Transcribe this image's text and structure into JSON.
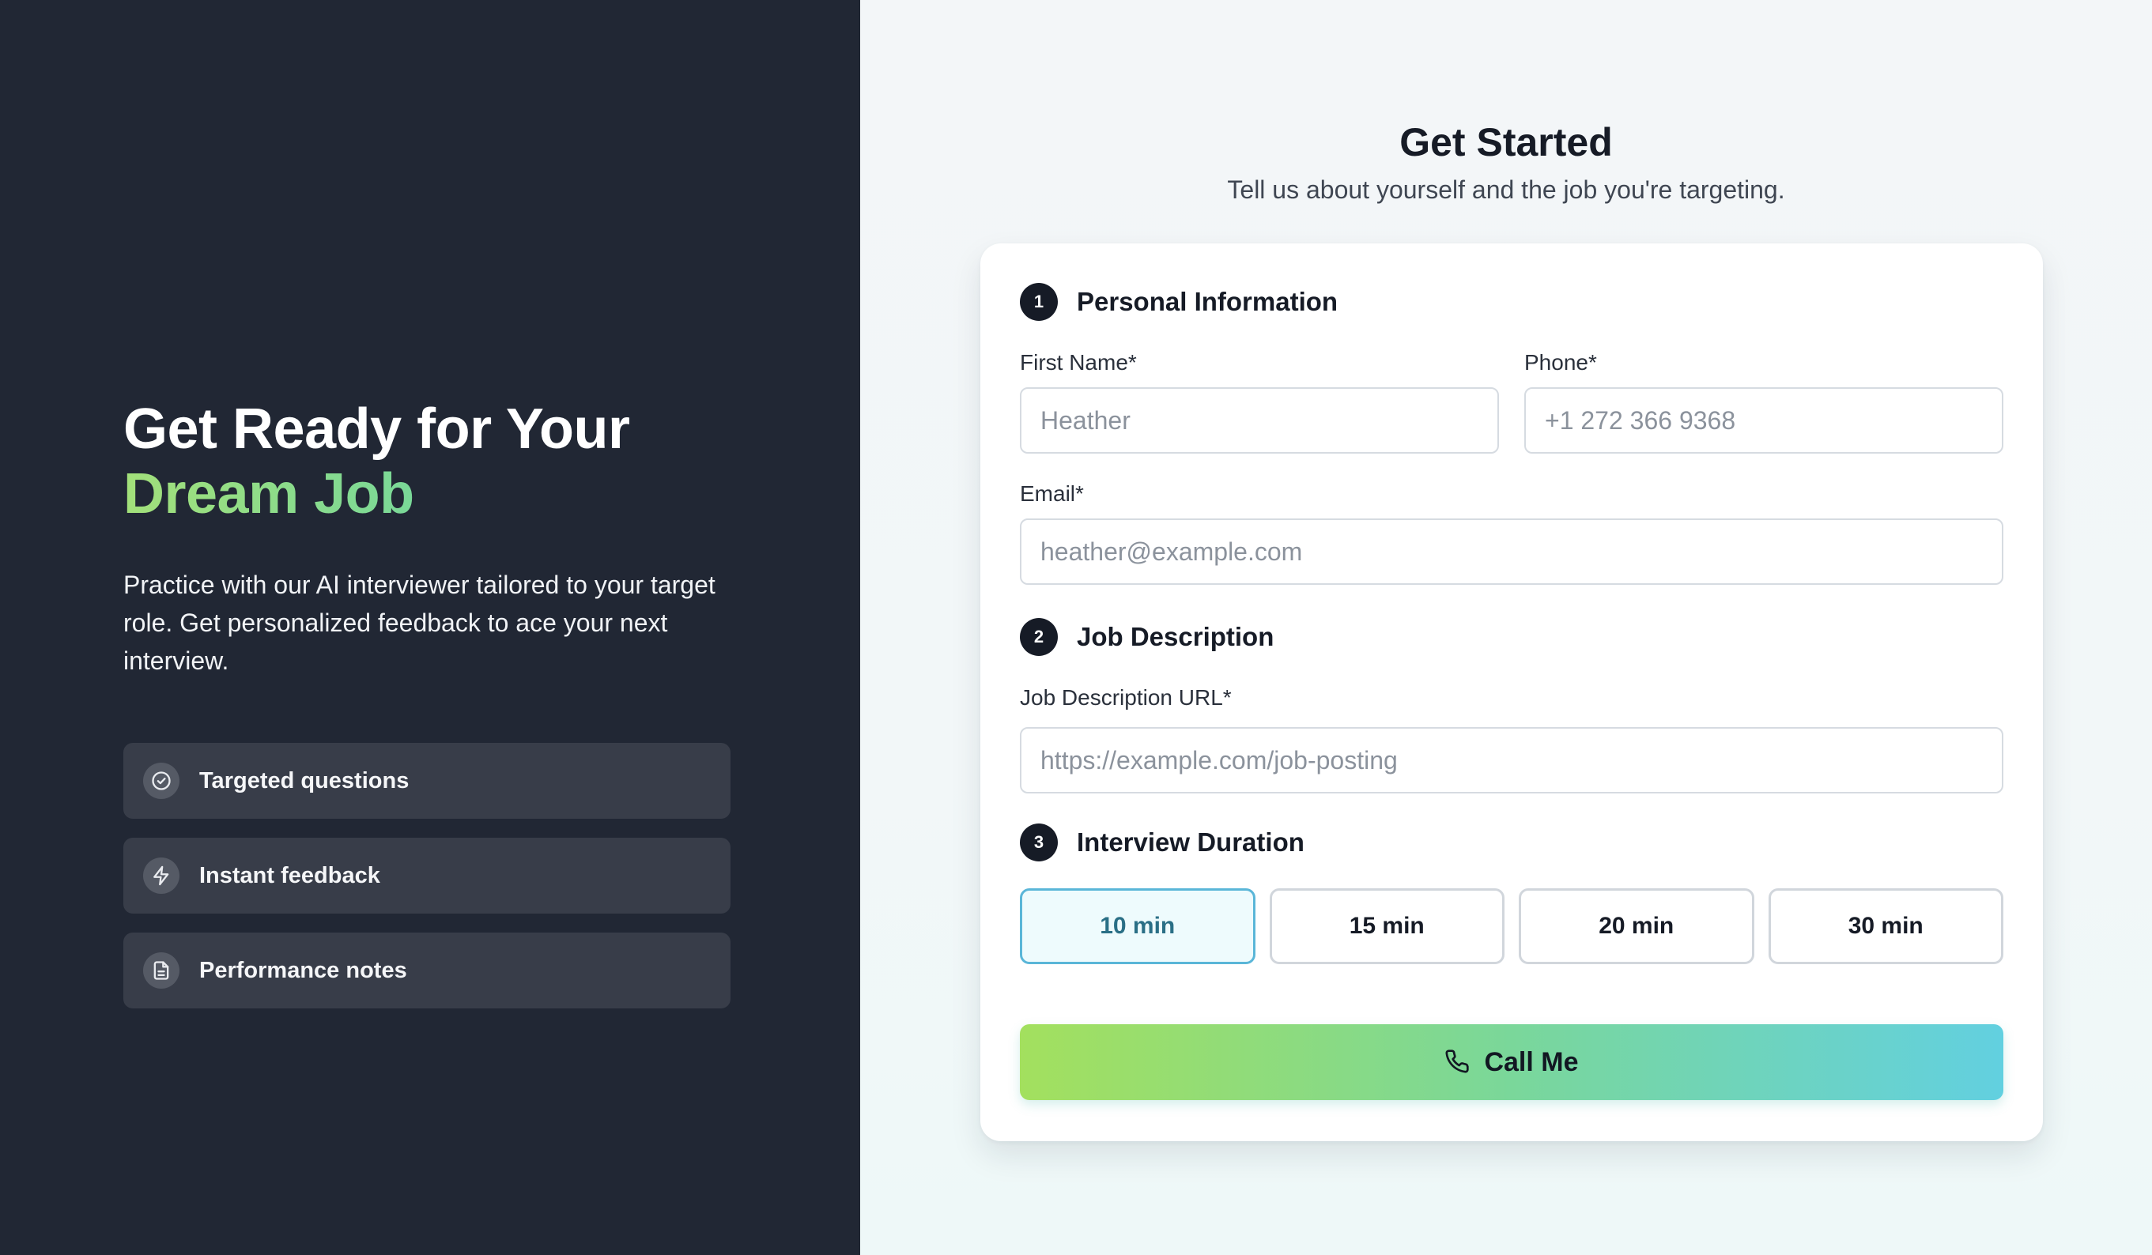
{
  "hero": {
    "title_line1": "Get Ready for Your",
    "title_line2": "Dream Job",
    "description": "Practice with our AI interviewer tailored to your target role. Get personalized feedback to ace your next interview.",
    "features": [
      {
        "label": "Targeted questions",
        "icon": "check-circle-icon"
      },
      {
        "label": "Instant feedback",
        "icon": "lightning-icon"
      },
      {
        "label": "Performance notes",
        "icon": "document-icon"
      }
    ]
  },
  "form": {
    "title": "Get Started",
    "subtitle": "Tell us about yourself and the job you're targeting.",
    "sections": [
      {
        "number": "1",
        "title": "Personal Information"
      },
      {
        "number": "2",
        "title": "Job Description"
      },
      {
        "number": "3",
        "title": "Interview Duration"
      }
    ],
    "first_name": {
      "label": "First Name*",
      "placeholder": "Heather",
      "value": ""
    },
    "phone": {
      "label": "Phone*",
      "placeholder": "+1 272 366 9368",
      "value": ""
    },
    "email": {
      "label": "Email*",
      "placeholder": "heather@example.com",
      "value": ""
    },
    "job_url": {
      "label": "Job Description URL*",
      "placeholder": "https://example.com/job-posting",
      "value": ""
    },
    "durations": [
      {
        "label": "10 min",
        "selected": true
      },
      {
        "label": "15 min",
        "selected": false
      },
      {
        "label": "20 min",
        "selected": false
      },
      {
        "label": "30 min",
        "selected": false
      }
    ],
    "submit_label": "Call Me",
    "submit_icon": "phone-icon"
  },
  "colors": {
    "left_panel_bg": "#212734",
    "accent_green": "#a3e07a",
    "selected_border": "#5ab6d8",
    "cta_gradient_start": "#a3e05e",
    "cta_gradient_end": "#62d0e0"
  }
}
